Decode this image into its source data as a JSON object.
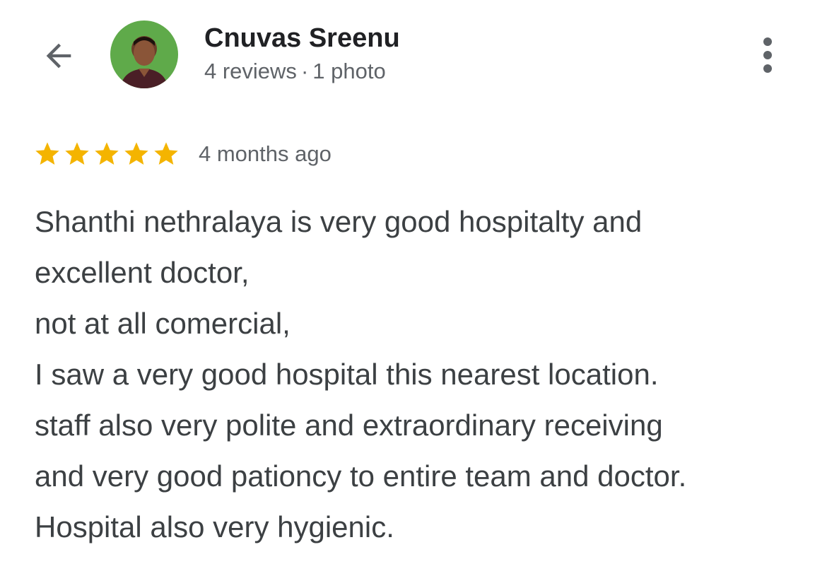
{
  "header": {
    "reviewer_name": "Cnuvas Sreenu",
    "reviews_count": "4 reviews",
    "separator": "·",
    "photos_count": "1 photo",
    "back_icon": "arrow-back-icon",
    "more_icon": "more-vert-icon"
  },
  "review": {
    "rating": 5,
    "rating_max": 5,
    "star_color": "#f4b400",
    "time_ago": "4 months ago",
    "lines": [
      "Shanthi nethralaya is very good hospitalty and",
      "excellent doctor,",
      "not at all comercial,",
      "I saw a very good hospital this nearest location.",
      "staff also very polite and extraordinary receiving",
      "and very good pationcy to entire team and doctor.",
      "Hospital also very hygienic."
    ]
  }
}
